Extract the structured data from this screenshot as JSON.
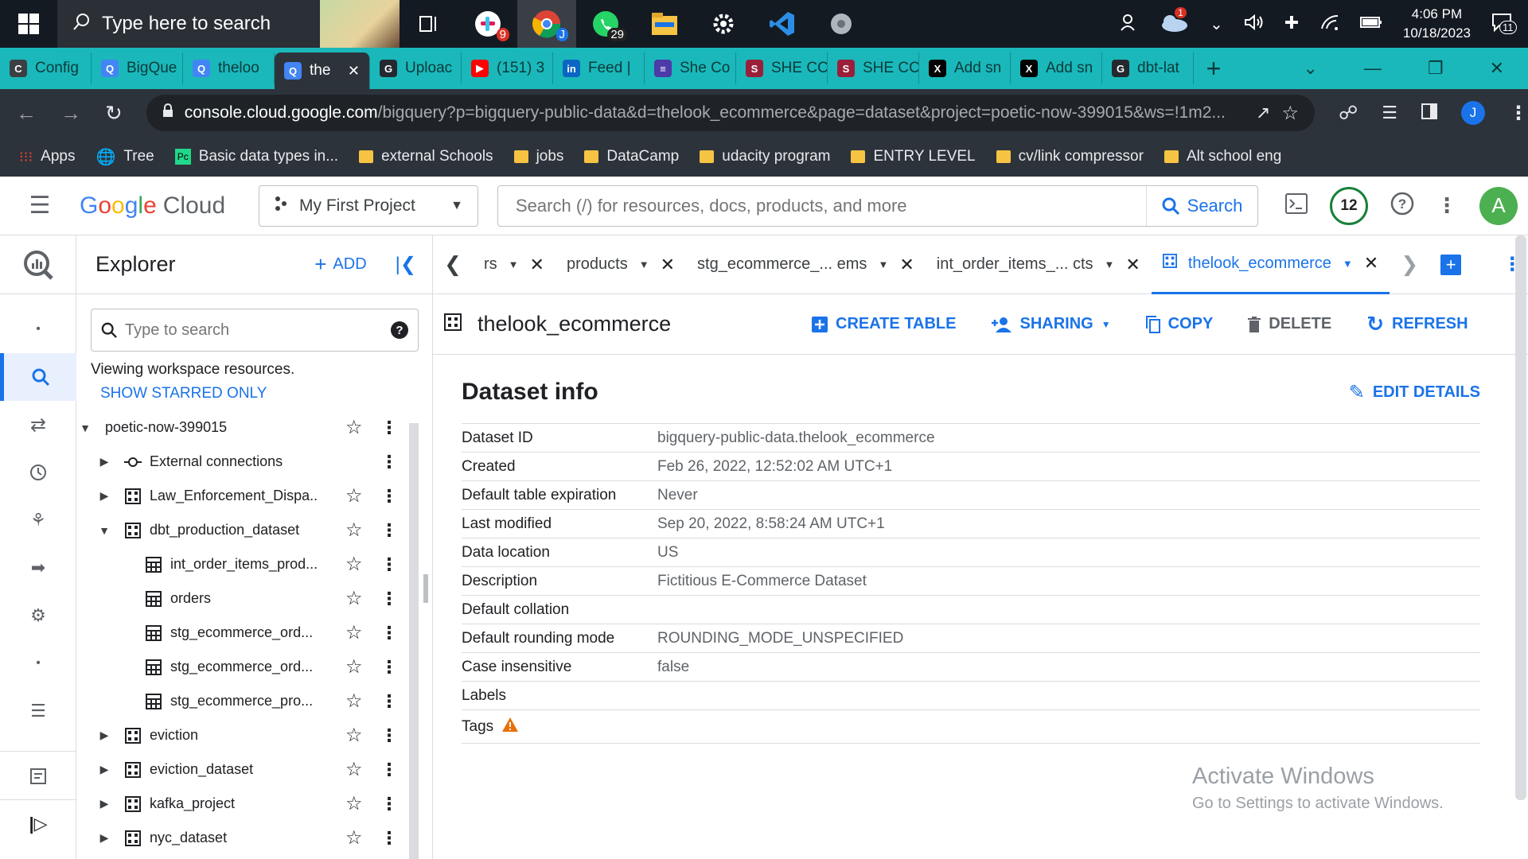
{
  "taskbar": {
    "search_placeholder": "Type here to search",
    "apps": [
      {
        "name": "task-view-icon"
      },
      {
        "name": "slack-icon",
        "badge": "9"
      },
      {
        "name": "chrome-icon",
        "badge": "J"
      },
      {
        "name": "whatsapp-icon",
        "badge": "29"
      },
      {
        "name": "file-explorer-icon"
      },
      {
        "name": "settings-icon"
      },
      {
        "name": "vscode-icon"
      },
      {
        "name": "media-icon"
      }
    ],
    "weather_badge": "1",
    "notif_count": "11",
    "time": "4:06 PM",
    "date": "10/18/2023"
  },
  "chrome": {
    "tabs": [
      {
        "label": "Config",
        "color": "#3c4043",
        "icon": "C"
      },
      {
        "label": "BigQue",
        "color": "#4285f4",
        "icon": "Q"
      },
      {
        "label": "theloo",
        "color": "#4285f4",
        "icon": "Q"
      },
      {
        "label": "the",
        "color": "#4285f4",
        "icon": "Q",
        "active": true
      },
      {
        "label": "Uploac",
        "color": "#24292f",
        "icon": "G"
      },
      {
        "label": "(151) 3",
        "color": "#ff0000",
        "icon": "▶"
      },
      {
        "label": "Feed |",
        "color": "#0a66c2",
        "icon": "in"
      },
      {
        "label": "She Co",
        "color": "#4b3aa8",
        "icon": "≡"
      },
      {
        "label": "SHE CC",
        "color": "#9a1f3a",
        "icon": "S"
      },
      {
        "label": "SHE CC",
        "color": "#9a1f3a",
        "icon": "S"
      },
      {
        "label": "Add sn",
        "color": "#000000",
        "icon": "X"
      },
      {
        "label": "Add sn",
        "color": "#000000",
        "icon": "X"
      },
      {
        "label": "dbt-lat",
        "color": "#24292f",
        "icon": "G"
      }
    ],
    "url_host": "console.cloud.google.com",
    "url_path": "/bigquery?p=bigquery-public-data&d=thelook_ecommerce&page=dataset&project=poetic-now-399015&ws=!1m2...",
    "profile_initial": "J",
    "bookmarks": [
      {
        "label": "Apps",
        "type": "apps"
      },
      {
        "label": "Tree",
        "type": "globe"
      },
      {
        "label": "Basic data types in...",
        "type": "pycharm"
      },
      {
        "label": "external Schools",
        "type": "folder"
      },
      {
        "label": "jobs",
        "type": "folder"
      },
      {
        "label": "DataCamp",
        "type": "folder"
      },
      {
        "label": "udacity program",
        "type": "folder"
      },
      {
        "label": "ENTRY LEVEL",
        "type": "folder"
      },
      {
        "label": "cv/link compressor",
        "type": "folder"
      },
      {
        "label": "Alt school eng",
        "type": "folder"
      }
    ]
  },
  "gcp": {
    "logo_google": "Google",
    "logo_cloud": "Cloud",
    "project": "My First Project",
    "search_placeholder": "Search (/) for resources, docs, products, and more",
    "search_button": "Search",
    "notifications": "12",
    "user_initial": "A"
  },
  "explorer": {
    "title": "Explorer",
    "add_label": "ADD",
    "search_placeholder": "Type to search",
    "viewing_text": "Viewing workspace resources.",
    "starred_link": "SHOW STARRED ONLY",
    "tree": [
      {
        "label": "poetic-now-399015",
        "level": 0,
        "toggle": "open",
        "icon": "none"
      },
      {
        "label": "External connections",
        "level": 1,
        "toggle": "closed",
        "icon": "connection",
        "nostar": true
      },
      {
        "label": "Law_Enforcement_Dispa...",
        "level": 1,
        "toggle": "closed",
        "icon": "dataset"
      },
      {
        "label": "dbt_production_dataset",
        "level": 1,
        "toggle": "open",
        "icon": "dataset"
      },
      {
        "label": "int_order_items_prod...",
        "level": 2,
        "toggle": "none",
        "icon": "table"
      },
      {
        "label": "orders",
        "level": 2,
        "toggle": "none",
        "icon": "table"
      },
      {
        "label": "stg_ecommerce_ord...",
        "level": 2,
        "toggle": "none",
        "icon": "table"
      },
      {
        "label": "stg_ecommerce_ord...",
        "level": 2,
        "toggle": "none",
        "icon": "table"
      },
      {
        "label": "stg_ecommerce_pro...",
        "level": 2,
        "toggle": "none",
        "icon": "table"
      },
      {
        "label": "eviction",
        "level": 1,
        "toggle": "closed",
        "icon": "dataset"
      },
      {
        "label": "eviction_dataset",
        "level": 1,
        "toggle": "closed",
        "icon": "dataset"
      },
      {
        "label": "kafka_project",
        "level": 1,
        "toggle": "closed",
        "icon": "dataset"
      },
      {
        "label": "nyc_dataset",
        "level": 1,
        "toggle": "closed",
        "icon": "dataset"
      }
    ]
  },
  "main": {
    "tabs": [
      {
        "label": "rs",
        "dropdown": true
      },
      {
        "label": "products",
        "dropdown": true
      },
      {
        "label": "stg_ecommerce_... ems",
        "dropdown": true
      },
      {
        "label": "int_order_items_... cts",
        "dropdown": true
      },
      {
        "label": "thelook_ecommerce",
        "dropdown": true,
        "active": true
      }
    ],
    "dataset_name": "thelook_ecommerce",
    "actions": {
      "create_table": "CREATE TABLE",
      "sharing": "SHARING",
      "copy": "COPY",
      "delete": "DELETE",
      "refresh": "REFRESH"
    },
    "info_title": "Dataset info",
    "edit_details": "EDIT DETAILS",
    "info_rows": [
      {
        "key": "Dataset ID",
        "value": "bigquery-public-data.thelook_ecommerce"
      },
      {
        "key": "Created",
        "value": "Feb 26, 2022, 12:52:02 AM UTC+1"
      },
      {
        "key": "Default table expiration",
        "value": "Never"
      },
      {
        "key": "Last modified",
        "value": "Sep 20, 2022, 8:58:24 AM UTC+1"
      },
      {
        "key": "Data location",
        "value": "US"
      },
      {
        "key": "Description",
        "value": "Fictitious E-Commerce Dataset"
      },
      {
        "key": "Default collation",
        "value": ""
      },
      {
        "key": "Default rounding mode",
        "value": "ROUNDING_MODE_UNSPECIFIED"
      },
      {
        "key": "Case insensitive",
        "value": "false"
      },
      {
        "key": "Labels",
        "value": ""
      },
      {
        "key": "Tags",
        "value": "",
        "warning": true
      }
    ],
    "watermark_title": "Activate Windows",
    "watermark_sub": "Go to Settings to activate Windows."
  }
}
